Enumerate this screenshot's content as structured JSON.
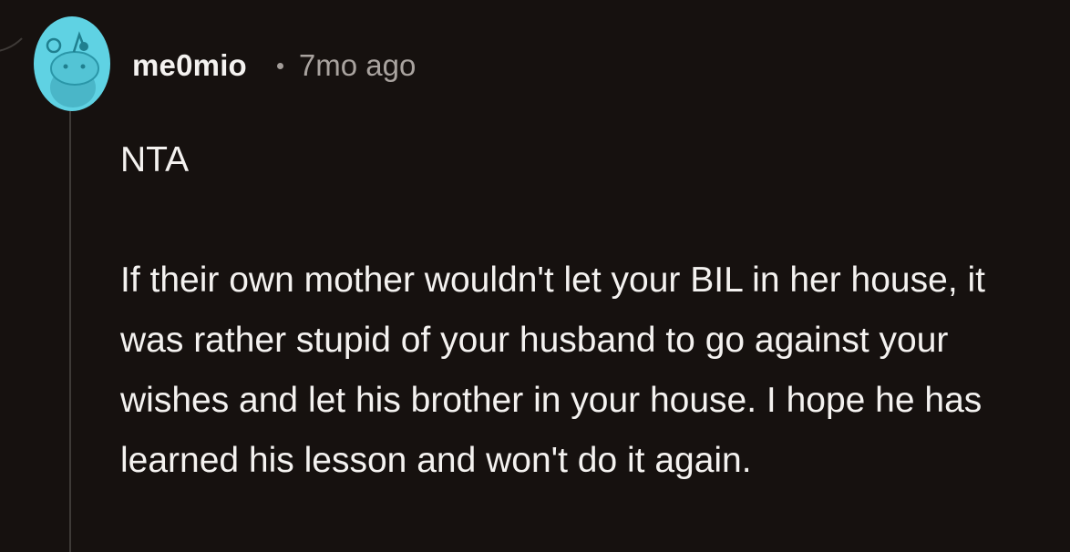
{
  "comment": {
    "author": "me0mio",
    "separator": "•",
    "timestamp": "7mo ago",
    "verdict": "NTA",
    "body": "If their own mother wouldn't let your BIL in her house, it was rather stupid of your husband to go against your wishes and let his brother in your house. I hope he has learned his lesson and won't do it again."
  },
  "avatar": {
    "icon": "snoo-avatar-icon",
    "background_color": "#5fd2e3"
  },
  "colors": {
    "background": "#16110f",
    "text": "#f4f2f0",
    "muted_text": "#a9a39f",
    "thread_line": "#3e3a37"
  }
}
